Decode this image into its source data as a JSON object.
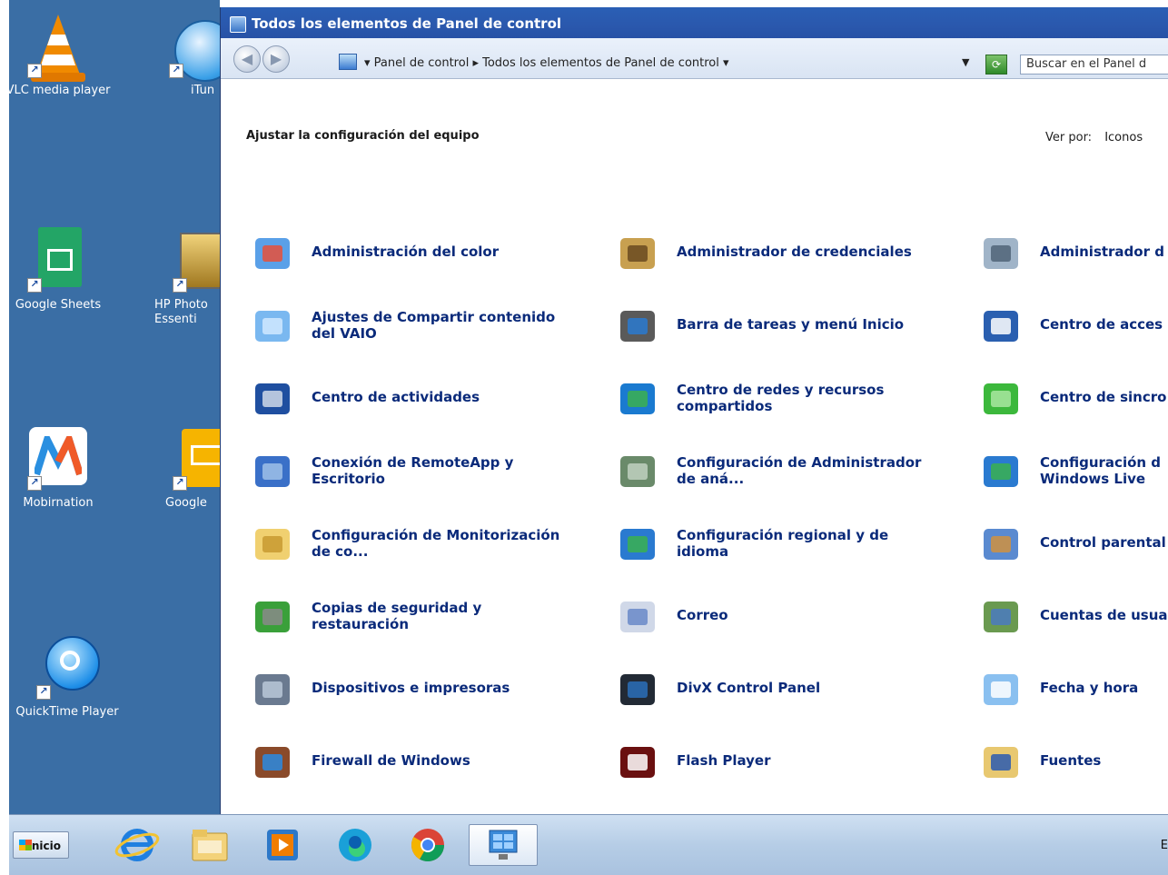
{
  "desktop": {
    "icons": [
      {
        "label": "VLC media player"
      },
      {
        "label": "iTun"
      },
      {
        "label": "Google Sheets"
      },
      {
        "label": "HP Photo Essenti"
      },
      {
        "label": "Mobirnation"
      },
      {
        "label": "Google"
      },
      {
        "label": "QuickTime Player"
      }
    ]
  },
  "window": {
    "title": "Todos los elementos de Panel de control",
    "breadcrumb": "▾  Panel de control  ▸  Todos los elementos de Panel de control  ▾",
    "search_placeholder": "Buscar en el Panel d",
    "heading": "Ajustar la configuración del equipo",
    "view_by_label": "Ver por:",
    "view_by_value": "Iconos",
    "items": [
      {
        "label": "Administración del color",
        "icon": "color-management-icon"
      },
      {
        "label": "Administrador de credenciales",
        "icon": "credential-manager-icon"
      },
      {
        "label": "Administrador d",
        "icon": "device-manager-icon"
      },
      {
        "label": "Ajustes de Compartir contenido\ndel VAIO",
        "icon": "vaio-share-icon"
      },
      {
        "label": "Barra de tareas y menú Inicio",
        "icon": "taskbar-start-icon"
      },
      {
        "label": "Centro de acces",
        "icon": "ease-of-access-icon"
      },
      {
        "label": "Centro de actividades",
        "icon": "action-center-flag-icon"
      },
      {
        "label": "Centro de redes y recursos\ncompartidos",
        "icon": "network-sharing-icon"
      },
      {
        "label": "Centro de sincro",
        "icon": "sync-center-icon"
      },
      {
        "label": "Conexión de RemoteApp y\nEscritorio",
        "icon": "remoteapp-icon"
      },
      {
        "label": "Configuración de Administrador\nde aná...",
        "icon": "analysis-admin-icon"
      },
      {
        "label": "Configuración d\nWindows Live",
        "icon": "windows-live-globe-icon"
      },
      {
        "label": "Configuración de Monitorización\nde co...",
        "icon": "monitoring-folder-icon"
      },
      {
        "label": "Configuración regional y de\nidioma",
        "icon": "region-language-icon"
      },
      {
        "label": "Control parental",
        "icon": "parental-control-icon"
      },
      {
        "label": "Copias de seguridad y\nrestauración",
        "icon": "backup-restore-icon"
      },
      {
        "label": "Correo",
        "icon": "mail-icon"
      },
      {
        "label": "Cuentas de usua",
        "icon": "user-accounts-icon"
      },
      {
        "label": "Dispositivos e impresoras",
        "icon": "devices-printers-icon"
      },
      {
        "label": "DivX Control Panel",
        "icon": "divx-icon"
      },
      {
        "label": "Fecha y hora",
        "icon": "date-time-icon"
      },
      {
        "label": "Firewall de Windows",
        "icon": "firewall-icon"
      },
      {
        "label": "Flash Player",
        "icon": "flash-player-icon"
      },
      {
        "label": "Fuentes",
        "icon": "fonts-icon"
      }
    ]
  },
  "taskbar": {
    "start_label": "Inicio",
    "apps": [
      "internet-explorer-icon",
      "file-explorer-icon",
      "media-player-icon",
      "edge-icon",
      "chrome-icon",
      "control-panel-icon"
    ],
    "clock_fragment": "E"
  }
}
